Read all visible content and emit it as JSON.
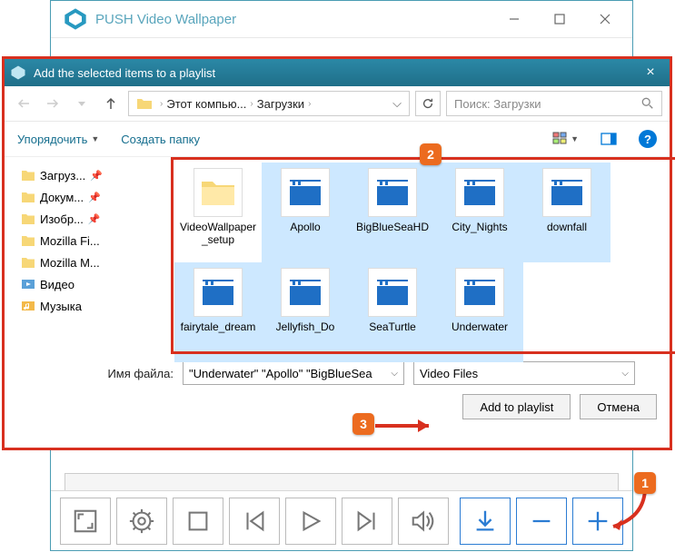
{
  "parent": {
    "title": "PUSH Video Wallpaper"
  },
  "dialog": {
    "title": "Add the selected items to a playlist",
    "breadcrumb": {
      "p1": "Этот компью...",
      "p2": "Загрузки"
    },
    "search_placeholder": "Поиск: Загрузки",
    "toolbar": {
      "organize": "Упорядочить",
      "new_folder": "Создать папку"
    },
    "nav": {
      "downloads": "Загруз...",
      "documents": "Докум...",
      "pictures": "Изобр...",
      "mozilla_fi": "Mozilla Fi...",
      "mozilla_m": "Mozilla M...",
      "video": "Видео",
      "music": "Музыка"
    },
    "items": {
      "setup": "VideoWallpaper_setup",
      "apollo": "Apollo",
      "bigblue": "BigBlueSeaHD",
      "city": "City_Nights",
      "downfall": "downfall",
      "fairy": "fairytale_dream",
      "jelly": "Jellyfish_Do",
      "turtle": "SeaTurtle",
      "under": "Underwater"
    },
    "footer": {
      "filename_label": "Имя файла:",
      "filename_value": "\"Underwater\" \"Apollo\" \"BigBlueSea",
      "filter": "Video Files",
      "add": "Add to playlist",
      "cancel": "Отмена"
    }
  },
  "annot": {
    "n1": "1",
    "n2": "2",
    "n3": "3"
  }
}
